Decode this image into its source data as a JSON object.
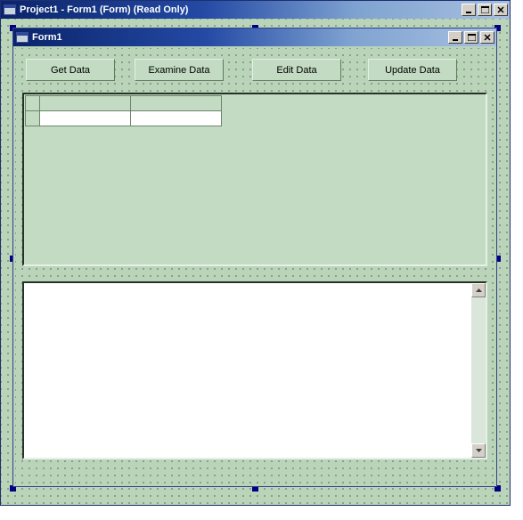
{
  "outer": {
    "title": "Project1 - Form1 (Form)  (Read Only)"
  },
  "inner": {
    "title": "Form1"
  },
  "buttons": {
    "get": "Get Data",
    "examine": "Examine Data",
    "edit": "Edit Data",
    "update": "Update Data"
  },
  "window_buttons": {
    "minimize": "_",
    "maximize": "□",
    "close": "×"
  },
  "grid": {
    "columns": 2,
    "rows": 1
  }
}
